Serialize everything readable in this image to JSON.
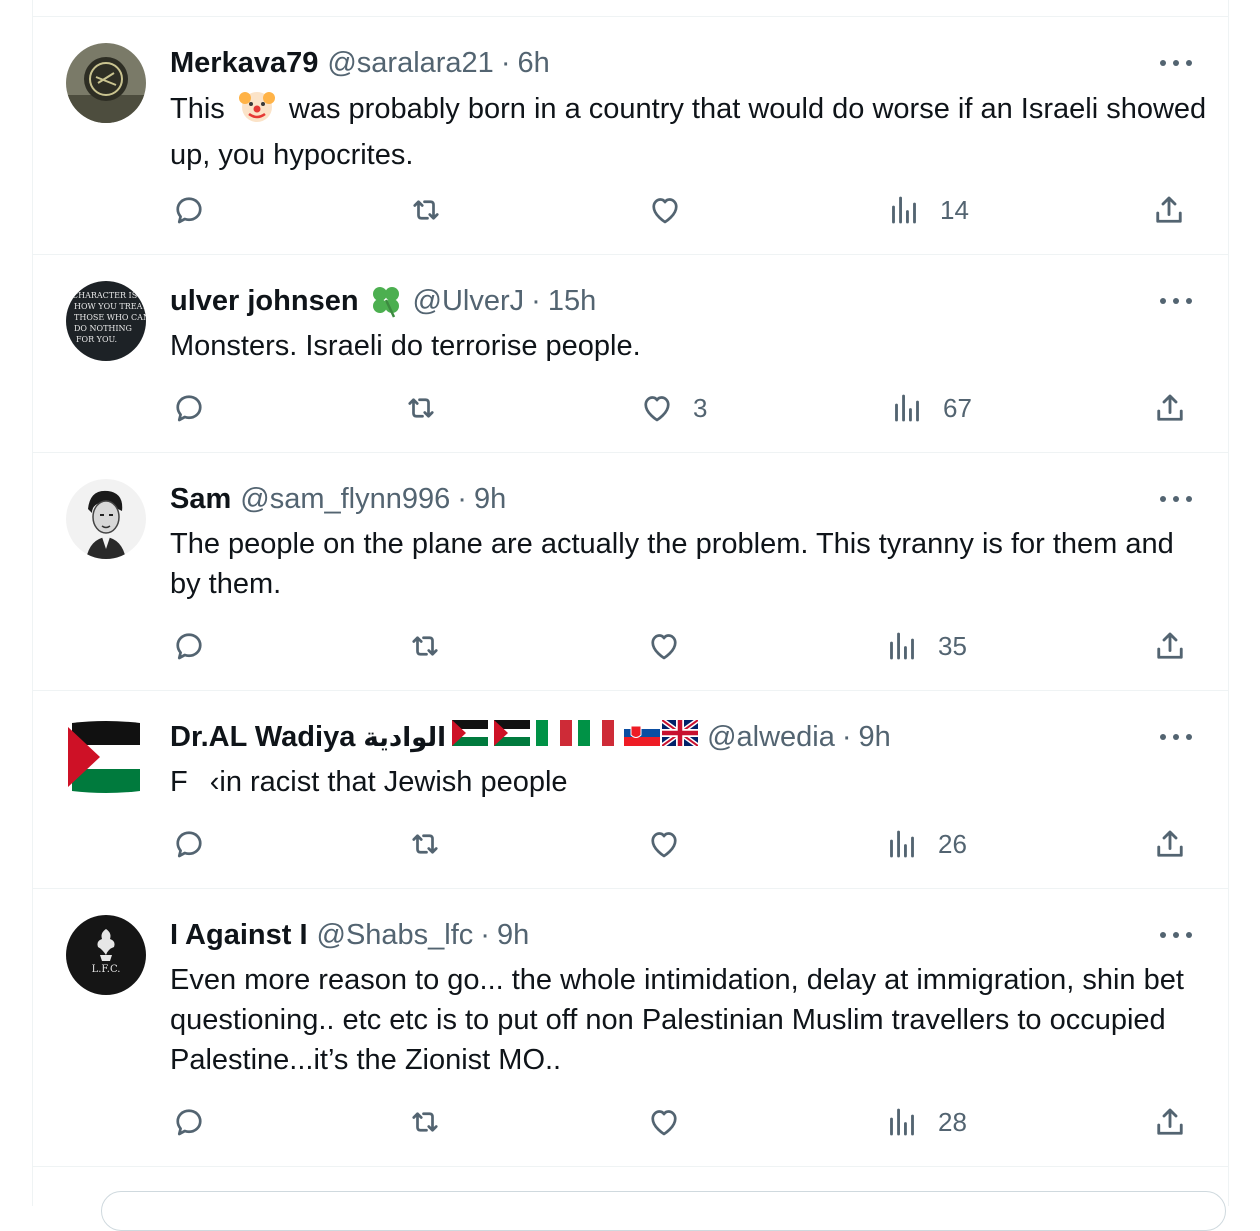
{
  "tweets": [
    {
      "name": "Merkava79",
      "handle": "@saralara21",
      "sep": "·",
      "time": "6h",
      "text": "This 🤡 was probably born in a country that would do worse if an Israeli showed up, you hypocrites.",
      "text_before": "This",
      "text_after": "was probably born in a country that would do worse if an Israeli showed up, you hypocrites.",
      "replies": "",
      "reposts": "",
      "likes": "",
      "views": "14"
    },
    {
      "name": "ulver johnsen",
      "handle": "@UlverJ",
      "sep": "·",
      "time": "15h",
      "text": "Monsters. Israeli do terrorise people.",
      "avatar_text": [
        "CHARACTER IS",
        "HOW YOU TREAT",
        "THOSE WHO CAN",
        "DO NOTHING",
        "FOR YOU."
      ],
      "replies": "",
      "reposts": "",
      "likes": "3",
      "views": "67"
    },
    {
      "name": "Sam",
      "handle": "@sam_flynn996",
      "sep": "·",
      "time": "9h",
      "text": "The people on the plane are actually the problem. This tyranny is for them and by them.",
      "replies": "",
      "reposts": "",
      "likes": "",
      "views": "35"
    },
    {
      "name": "Dr.AL Wadiya",
      "name_arabic": "الوادية",
      "handle": "@alwedia",
      "sep": "·",
      "time": "9h",
      "text_before": "F",
      "text_after": "‹in racist that Jewish people",
      "replies": "",
      "reposts": "",
      "likes": "",
      "views": "26"
    },
    {
      "name": "I Against I",
      "handle": "@Shabs_lfc",
      "sep": "·",
      "time": "9h",
      "text": "Even more reason to go... the whole intimidation, delay at immigration, shin bet questioning.. etc etc is to put off non Palestinian Muslim travellers to occupied Palestine...it’s the Zionist MO..",
      "avatar_text": "L.F.C.",
      "replies": "",
      "reposts": "",
      "likes": "",
      "views": "28"
    }
  ],
  "colors": {
    "text": "#0f1419",
    "secondary": "#536471",
    "border": "#eff3f4",
    "palestine_red": "#ce1126",
    "palestine_green": "#007a3d",
    "clover": "#4caf50"
  },
  "icons": [
    "reply-icon",
    "repost-icon",
    "like-icon",
    "views-icon",
    "share-icon",
    "more-icon"
  ]
}
